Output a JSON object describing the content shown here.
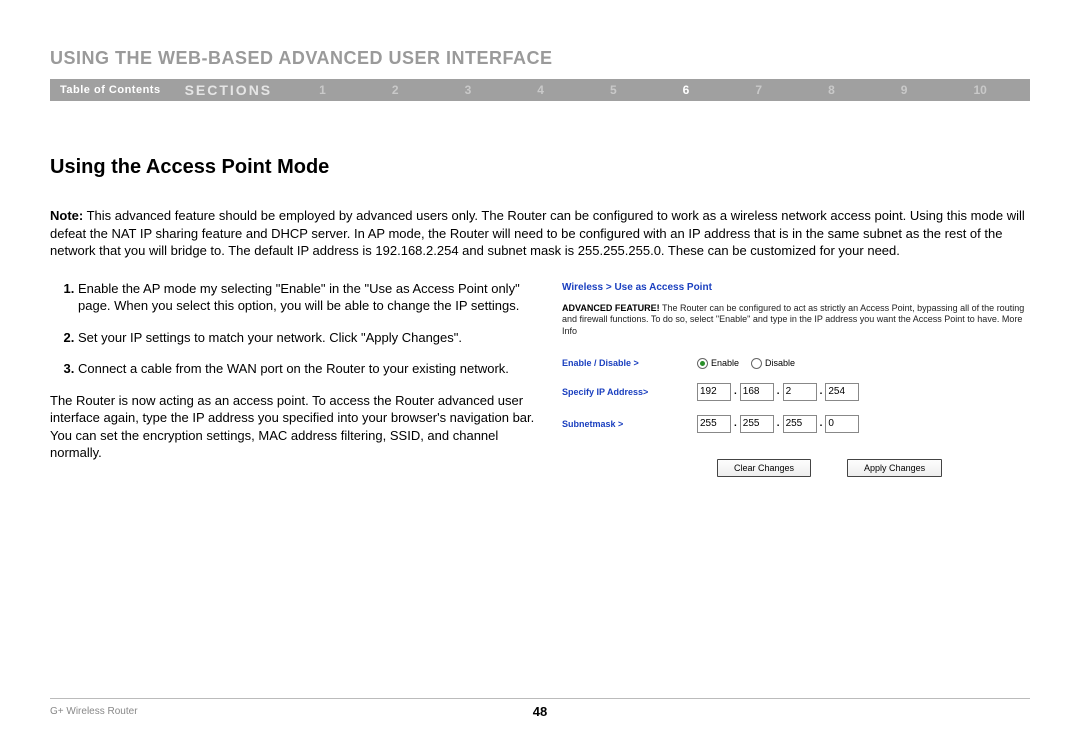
{
  "header": {
    "title": "USING THE WEB-BASED ADVANCED USER INTERFACE"
  },
  "nav": {
    "toc": "Table of Contents",
    "sections_label": "SECTIONS",
    "items": [
      "1",
      "2",
      "3",
      "4",
      "5",
      "6",
      "7",
      "8",
      "9",
      "10"
    ],
    "active_index": 5
  },
  "subheading": "Using the Access Point Mode",
  "note": {
    "label": "Note:",
    "text": " This advanced feature should be employed by advanced users only. The Router can be configured to work as a wireless network access point. Using this mode will defeat the NAT IP sharing feature and DHCP server. In AP mode, the Router will need to be configured with an IP address that is in the same subnet as the rest of the network that you will bridge to. The default IP address is 192.168.2.254 and subnet mask is 255.255.255.0. These can be customized for your need."
  },
  "steps": [
    "Enable the AP mode my selecting \"Enable\" in the \"Use as Access Point only\" page. When you select this option, you will be able to change the IP settings.",
    "Set your IP settings to match your network. Click \"Apply Changes\".",
    "Connect a cable from the WAN port on the Router to your existing network."
  ],
  "tail": "The Router is now acting as an access point. To access the Router advanced user interface again, type the IP address you specified into your browser's navigation bar. You can set the encryption settings, MAC address filtering, SSID, and channel normally.",
  "panel": {
    "breadcrumb": "Wireless > Use as Access Point",
    "adv_label": "ADVANCED FEATURE!",
    "adv_text": " The Router can be configured to act as strictly an Access Point, bypassing all of the routing and firewall functions. To do so, select \"Enable\" and type in the IP address you want the Access Point to have. More Info",
    "enable_label": "Enable / Disable >",
    "opt_enable": "Enable",
    "opt_disable": "Disable",
    "specify_label": "Specify IP Address>",
    "ip": [
      "192",
      "168",
      "2",
      "254"
    ],
    "subnet_label": "Subnetmask >",
    "subnet": [
      "255",
      "255",
      "255",
      "0"
    ],
    "btn_clear": "Clear Changes",
    "btn_apply": "Apply Changes"
  },
  "footer": {
    "product": "G+ Wireless Router",
    "page": "48"
  }
}
